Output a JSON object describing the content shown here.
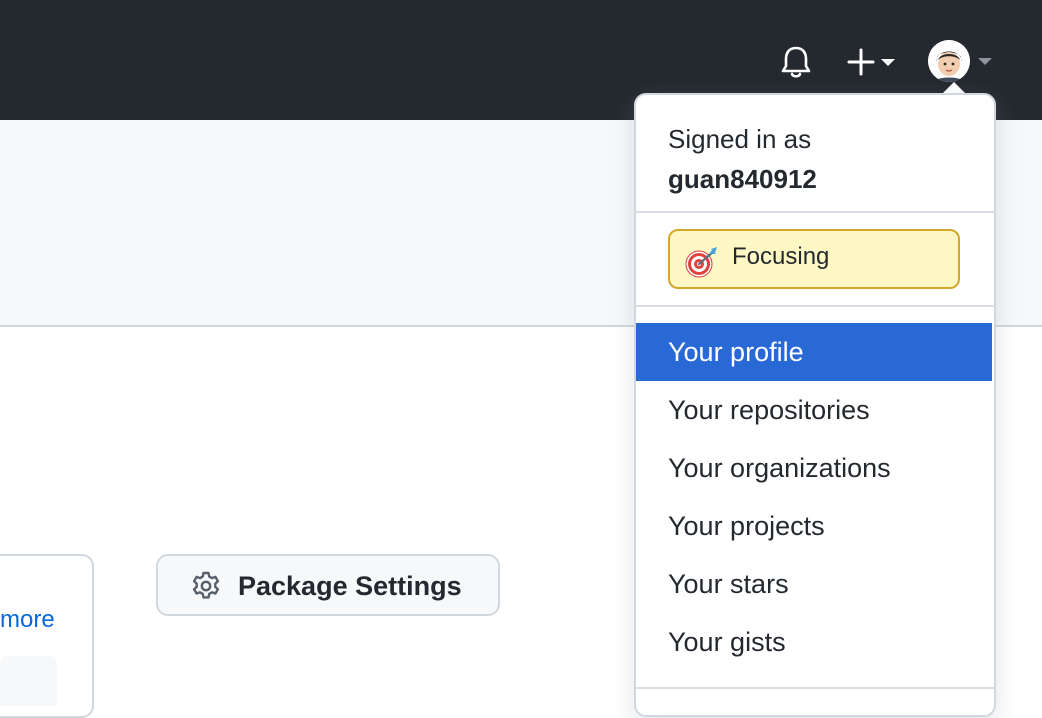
{
  "header": {
    "notifications_icon": "bell-icon",
    "create_icon": "plus-icon",
    "avatar_label": "user avatar"
  },
  "left_panel": {
    "more_link": "more"
  },
  "package_settings": {
    "label": "Package Settings",
    "icon": "gear-icon"
  },
  "user_menu": {
    "signed_in_label": "Signed in as",
    "username": "guan840912",
    "status": {
      "icon": "direct-hit-target-icon",
      "text": "Focusing"
    },
    "items": [
      {
        "label": "Your profile",
        "active": true
      },
      {
        "label": "Your repositories"
      },
      {
        "label": "Your organizations"
      },
      {
        "label": "Your projects"
      },
      {
        "label": "Your stars"
      },
      {
        "label": "Your gists"
      }
    ]
  },
  "colors": {
    "header_bg": "#24292f",
    "active_item_bg": "#2969d6",
    "status_bg": "#fff8c5",
    "link": "#0969da"
  }
}
